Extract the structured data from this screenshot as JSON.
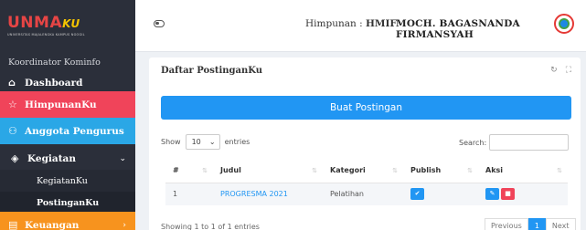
{
  "brand": {
    "logo_main": "UNMA",
    "logo_accent": "KU",
    "logo_sub": "UNIVERSITAS MAJALENGKA KAMPUS NGOGIL"
  },
  "sidebar": {
    "role": "Koordinator Kominfo",
    "items": [
      {
        "label": "Dashboard",
        "icon": "home-icon"
      },
      {
        "label": "HimpunanKu",
        "icon": "star-icon"
      },
      {
        "label": "Anggota Pengurus",
        "icon": "users-icon"
      },
      {
        "label": "Kegiatan",
        "icon": "layers-icon"
      },
      {
        "label": "Keuangan",
        "icon": "file-icon"
      }
    ],
    "sub_items": [
      {
        "label": "KegiatanKu"
      },
      {
        "label": "PostinganKu"
      }
    ],
    "colors": {
      "himpunan": "#f0445a",
      "anggota": "#2aa7e6",
      "keuangan": "#f7931e"
    }
  },
  "header": {
    "himpunan_label": "Himpunan :",
    "himpunan_value": "HMIF",
    "user_name": "MOCH. BAGASNANDA FIRMANSYAH"
  },
  "card": {
    "title": "Daftar PostinganKu",
    "create_button": "Buat Postingan",
    "show_label": "Show",
    "entries_value": "10",
    "entries_label": "entries",
    "search_label": "Search:",
    "columns": [
      "#",
      "Judul",
      "Kategori",
      "Publish",
      "Aksi"
    ],
    "rows": [
      {
        "no": "1",
        "judul": "PROGRESMA 2021",
        "kategori": "Pelatihan"
      }
    ],
    "info": "Showing 1 to 1 of 1 entries",
    "pager": {
      "previous": "Previous",
      "current": "1",
      "next": "Next"
    }
  }
}
